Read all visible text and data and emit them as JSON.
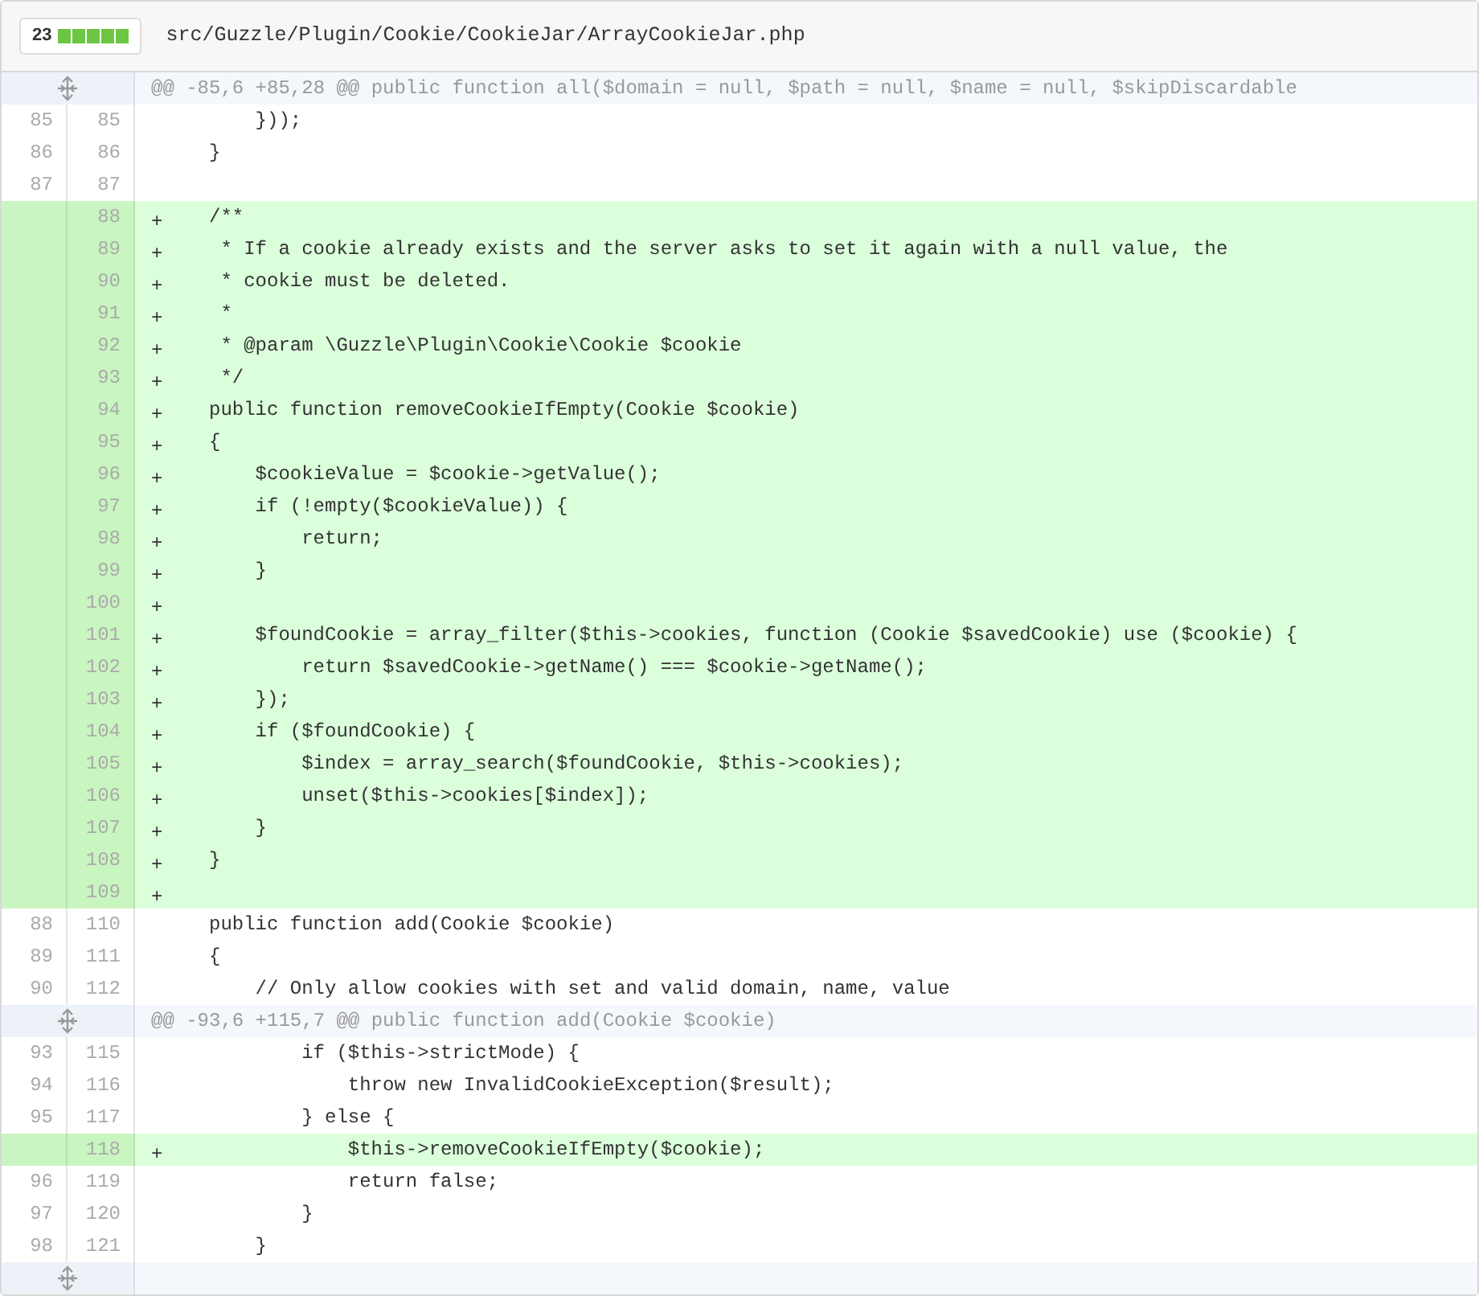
{
  "file_header": {
    "additions_count": "23",
    "path": "src/Guzzle/Plugin/Cookie/CookieJar/ArrayCookieJar.php"
  },
  "lines": [
    {
      "kind": "hunk",
      "code": "@@ -85,6 +85,28 @@ public function all($domain = null, $path = null, $name = null, $skipDiscardable"
    },
    {
      "kind": "context",
      "old": "85",
      "new": "85",
      "code": "        }));"
    },
    {
      "kind": "context",
      "old": "86",
      "new": "86",
      "code": "    }"
    },
    {
      "kind": "context",
      "old": "87",
      "new": "87"
    },
    {
      "kind": "addition",
      "new": "88",
      "marker": "+",
      "code": "    /**"
    },
    {
      "kind": "addition",
      "new": "89",
      "marker": "+",
      "code": "     * If a cookie already exists and the server asks to set it again with a null value, the"
    },
    {
      "kind": "addition",
      "new": "90",
      "marker": "+",
      "code": "     * cookie must be deleted."
    },
    {
      "kind": "addition",
      "new": "91",
      "marker": "+",
      "code": "     *"
    },
    {
      "kind": "addition",
      "new": "92",
      "marker": "+",
      "code": "     * @param \\Guzzle\\Plugin\\Cookie\\Cookie $cookie"
    },
    {
      "kind": "addition",
      "new": "93",
      "marker": "+",
      "code": "     */"
    },
    {
      "kind": "addition",
      "new": "94",
      "marker": "+",
      "code": "    public function removeCookieIfEmpty(Cookie $cookie)"
    },
    {
      "kind": "addition",
      "new": "95",
      "marker": "+",
      "code": "    {"
    },
    {
      "kind": "addition",
      "new": "96",
      "marker": "+",
      "code": "        $cookieValue = $cookie->getValue();"
    },
    {
      "kind": "addition",
      "new": "97",
      "marker": "+",
      "code": "        if (!empty($cookieValue)) {"
    },
    {
      "kind": "addition",
      "new": "98",
      "marker": "+",
      "code": "            return;"
    },
    {
      "kind": "addition",
      "new": "99",
      "marker": "+",
      "code": "        }"
    },
    {
      "kind": "addition",
      "new": "100",
      "marker": "+"
    },
    {
      "kind": "addition",
      "new": "101",
      "marker": "+",
      "code": "        $foundCookie = array_filter($this->cookies, function (Cookie $savedCookie) use ($cookie) {"
    },
    {
      "kind": "addition",
      "new": "102",
      "marker": "+",
      "code": "            return $savedCookie->getName() === $cookie->getName();"
    },
    {
      "kind": "addition",
      "new": "103",
      "marker": "+",
      "code": "        });"
    },
    {
      "kind": "addition",
      "new": "104",
      "marker": "+",
      "code": "        if ($foundCookie) {"
    },
    {
      "kind": "addition",
      "new": "105",
      "marker": "+",
      "code": "            $index = array_search($foundCookie, $this->cookies);"
    },
    {
      "kind": "addition",
      "new": "106",
      "marker": "+",
      "code": "            unset($this->cookies[$index]);"
    },
    {
      "kind": "addition",
      "new": "107",
      "marker": "+",
      "code": "        }"
    },
    {
      "kind": "addition",
      "new": "108",
      "marker": "+",
      "code": "    }"
    },
    {
      "kind": "addition",
      "new": "109",
      "marker": "+"
    },
    {
      "kind": "context",
      "old": "88",
      "new": "110",
      "code": "    public function add(Cookie $cookie)"
    },
    {
      "kind": "context",
      "old": "89",
      "new": "111",
      "code": "    {"
    },
    {
      "kind": "context",
      "old": "90",
      "new": "112",
      "code": "        // Only allow cookies with set and valid domain, name, value"
    },
    {
      "kind": "hunk",
      "code": "@@ -93,6 +115,7 @@ public function add(Cookie $cookie)"
    },
    {
      "kind": "context",
      "old": "93",
      "new": "115",
      "code": "            if ($this->strictMode) {"
    },
    {
      "kind": "context",
      "old": "94",
      "new": "116",
      "code": "                throw new InvalidCookieException($result);"
    },
    {
      "kind": "context",
      "old": "95",
      "new": "117",
      "code": "            } else {"
    },
    {
      "kind": "addition",
      "new": "118",
      "marker": "+",
      "code": "                $this->removeCookieIfEmpty($cookie);"
    },
    {
      "kind": "context",
      "old": "96",
      "new": "119",
      "code": "                return false;"
    },
    {
      "kind": "context",
      "old": "97",
      "new": "120",
      "code": "            }"
    },
    {
      "kind": "context",
      "old": "98",
      "new": "121",
      "code": "        }"
    },
    {
      "kind": "hunk"
    }
  ]
}
